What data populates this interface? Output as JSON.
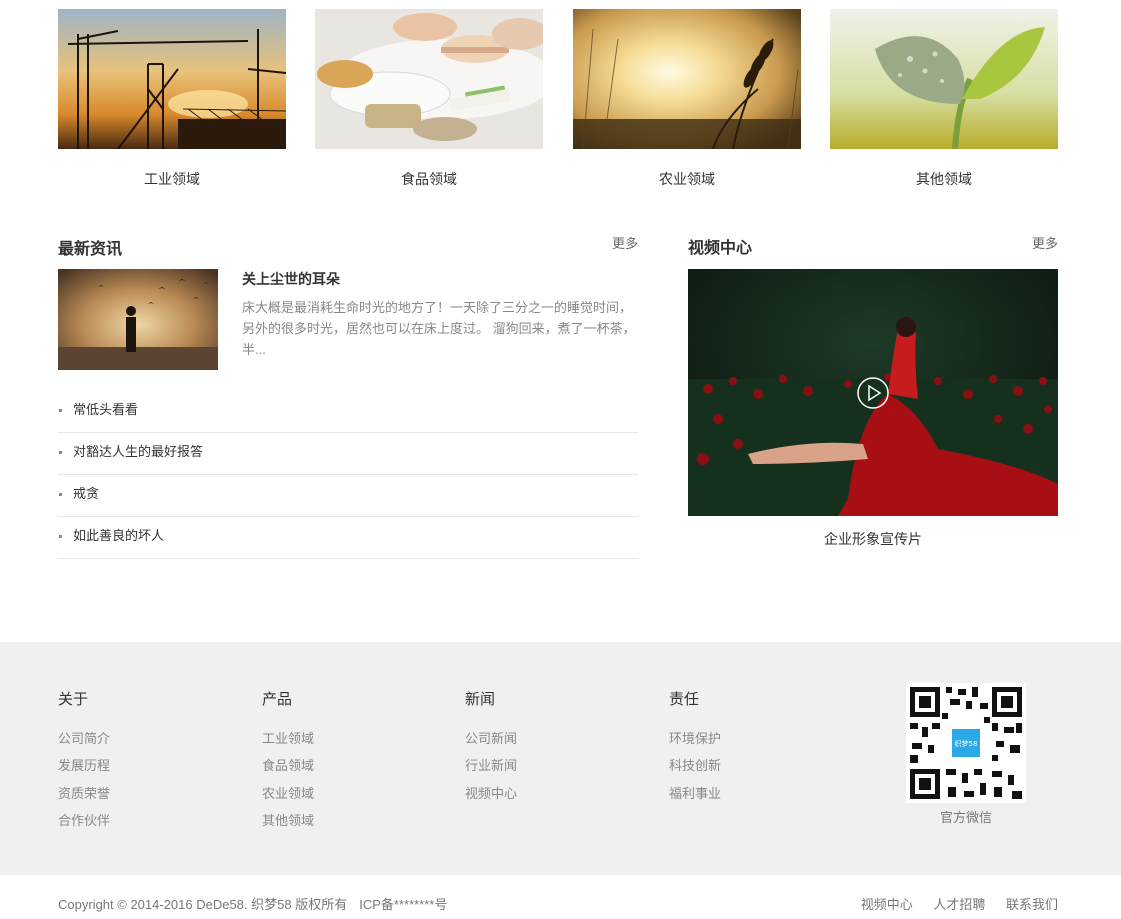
{
  "categories": [
    {
      "label": "工业领域",
      "image": "industry-crane-sunset"
    },
    {
      "label": "食品领域",
      "image": "macarons-food"
    },
    {
      "label": "农业领域",
      "image": "wheat-sunset"
    },
    {
      "label": "其他领域",
      "image": "green-sprout"
    }
  ],
  "news": {
    "title": "最新资讯",
    "more": "更多",
    "feature": {
      "title": "关上尘世的耳朵",
      "summary": "床大概是最消耗生命时光的地方了！一天除了三分之一的睡觉时间，另外的很多时光，居然也可以在床上度过。 溜狗回来，煮了一杯茶，半..."
    },
    "items": [
      "常低头看看",
      "对豁达人生的最好报答",
      "戒贪",
      "如此善良的坏人"
    ]
  },
  "video": {
    "title": "视频中心",
    "more": "更多",
    "caption": "企业形象宣传片",
    "play_icon": "play-circle-icon"
  },
  "footer": {
    "columns": [
      {
        "heading": "关于",
        "links": [
          "公司简介",
          "发展历程",
          "资质荣誉",
          "合作伙伴"
        ]
      },
      {
        "heading": "产品",
        "links": [
          "工业领域",
          "食品领域",
          "农业领域",
          "其他领域"
        ]
      },
      {
        "heading": "新闻",
        "links": [
          "公司新闻",
          "行业新闻",
          "视频中心"
        ]
      },
      {
        "heading": "责任",
        "links": [
          "环境保护",
          "科技创新",
          "福利事业"
        ]
      }
    ],
    "qr_label": "官方微信",
    "qr_center": "织梦58"
  },
  "bottom": {
    "copyright": "Copyright © 2014-2016 DeDe58. 织梦58 版权所有",
    "icp": "ICP备********号",
    "links": [
      "视频中心",
      "人才招聘",
      "联系我们"
    ]
  },
  "colors": {
    "footer_bg": "#f0f0f0",
    "qr_accent": "#2aa8e8"
  }
}
